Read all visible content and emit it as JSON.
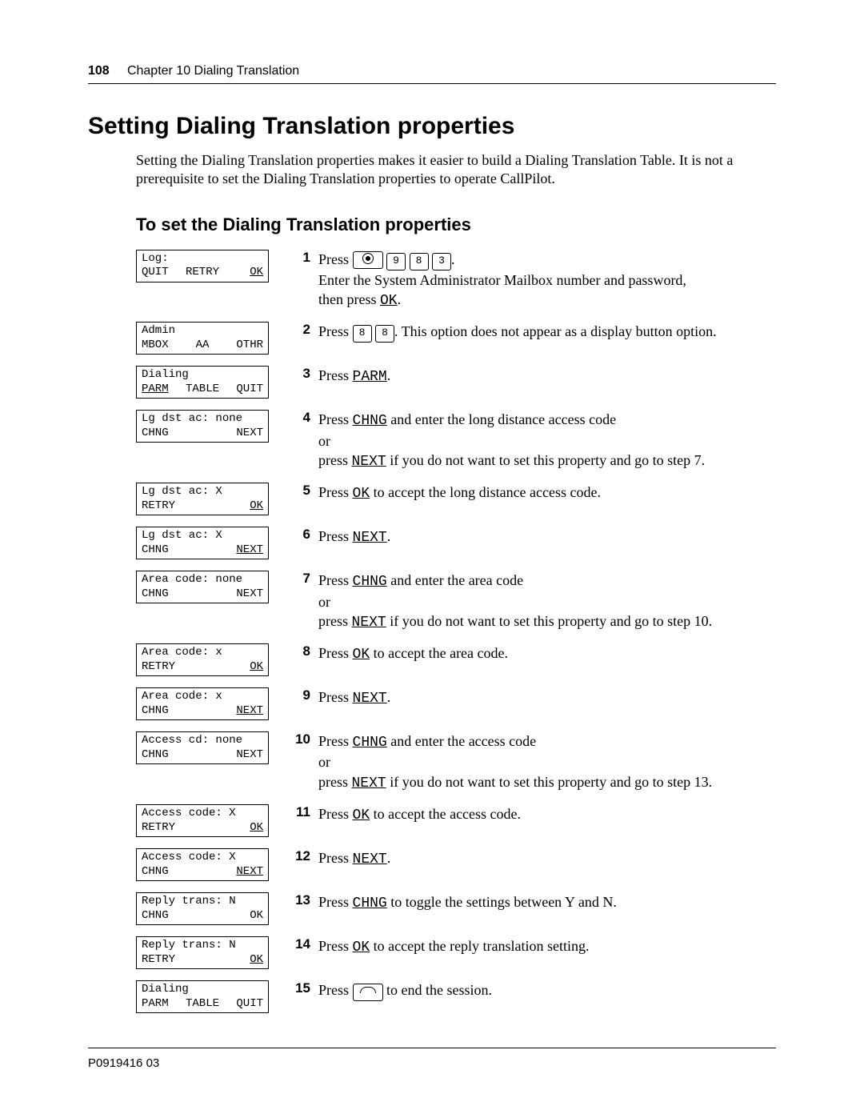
{
  "header": {
    "page_number": "108",
    "chapter": "Chapter 10  Dialing Translation"
  },
  "h1": "Setting Dialing Translation properties",
  "intro": "Setting the Dialing Translation properties makes it easier to build a Dialing Translation Table. It is not a prerequisite to set the Dialing Translation properties to operate CallPilot.",
  "h2": "To set the Dialing Translation properties",
  "labels": {
    "press": "Press ",
    "or": "or",
    "then_press": "then press ",
    "period": "."
  },
  "steps": [
    {
      "num": "1",
      "display": {
        "line1": "Log:",
        "l": "QUIT",
        "c": "RETRY",
        "r": "OK",
        "r_und": true
      },
      "keys": [
        "feat",
        "9",
        "8",
        "3"
      ],
      "after_keys": ".",
      "extra_lines": [
        "Enter the System Administrator Mailbox number and password,"
      ],
      "then_ok": true
    },
    {
      "num": "2",
      "display": {
        "line1": "Admin",
        "l": "MBOX",
        "c": "AA",
        "r": "OTHR"
      },
      "keys": [
        "8",
        "8"
      ],
      "after_keys": ". This option does not appear as a display button option."
    },
    {
      "num": "3",
      "display": {
        "line1": "Dialing",
        "l": "PARM",
        "l_und": true,
        "c": "TABLE",
        "r": "QUIT"
      },
      "press_label": "PARM",
      "after": "."
    },
    {
      "num": "4",
      "display": {
        "line1": "Lg dst ac: none",
        "l": "CHNG",
        "c": "",
        "r": "NEXT"
      },
      "press_label": "CHNG",
      "after": " and enter the long distance access code",
      "or_line": true,
      "or_press": "NEXT",
      "or_after": " if you do not want to set this property and go to step 7."
    },
    {
      "num": "5",
      "display": {
        "line1": "Lg dst ac: X",
        "l": "RETRY",
        "c": "",
        "r": "OK",
        "r_und": true
      },
      "press_label": "OK",
      "after": " to accept the long distance access code."
    },
    {
      "num": "6",
      "display": {
        "line1": "Lg dst ac: X",
        "l": "CHNG",
        "c": "",
        "r": "NEXT",
        "r_und": true
      },
      "press_label": "NEXT",
      "after": "."
    },
    {
      "num": "7",
      "display": {
        "line1": "Area code: none",
        "l": "CHNG",
        "c": "",
        "r": "NEXT"
      },
      "press_label": "CHNG",
      "after": " and enter the area code",
      "or_line": true,
      "or_press": "NEXT",
      "or_after": " if you do not want to set this property and go to step 10."
    },
    {
      "num": "8",
      "display": {
        "line1": "Area code: x",
        "l": "RETRY",
        "c": "",
        "r": "OK",
        "r_und": true
      },
      "press_label": "OK",
      "after": " to accept the area code."
    },
    {
      "num": "9",
      "display": {
        "line1": "Area code: x",
        "l": "CHNG",
        "c": "",
        "r": "NEXT",
        "r_und": true
      },
      "press_label": "NEXT",
      "after": "."
    },
    {
      "num": "10",
      "display": {
        "line1": "Access cd: none",
        "l": "CHNG",
        "c": "",
        "r": "NEXT"
      },
      "press_label": "CHNG",
      "after": " and enter the access code",
      "or_line": true,
      "or_press": "NEXT",
      "or_after": " if you do not want to set this property and go to step 13."
    },
    {
      "num": "11",
      "display": {
        "line1": "Access code: X",
        "l": "RETRY",
        "c": "",
        "r": "OK",
        "r_und": true
      },
      "press_label": "OK",
      "after": " to accept the access code."
    },
    {
      "num": "12",
      "display": {
        "line1": "Access code: X",
        "l": "CHNG",
        "c": "",
        "r": "NEXT",
        "r_und": true
      },
      "press_label": "NEXT",
      "after": "."
    },
    {
      "num": "13",
      "display": {
        "line1": "Reply trans: N",
        "l": "CHNG",
        "c": "",
        "r": "OK"
      },
      "press_label": "CHNG",
      "after": " to toggle the settings between Y and N."
    },
    {
      "num": "14",
      "display": {
        "line1": "Reply trans: N",
        "l": "RETRY",
        "c": "",
        "r": "OK",
        "r_und": true
      },
      "press_label": "OK",
      "after": " to accept the reply translation setting."
    },
    {
      "num": "15",
      "display": {
        "line1": "Dialing",
        "l": "PARM",
        "c": "TABLE",
        "r": "QUIT"
      },
      "hang_key": true,
      "after": " to end the session."
    }
  ],
  "footer": "P0919416 03"
}
